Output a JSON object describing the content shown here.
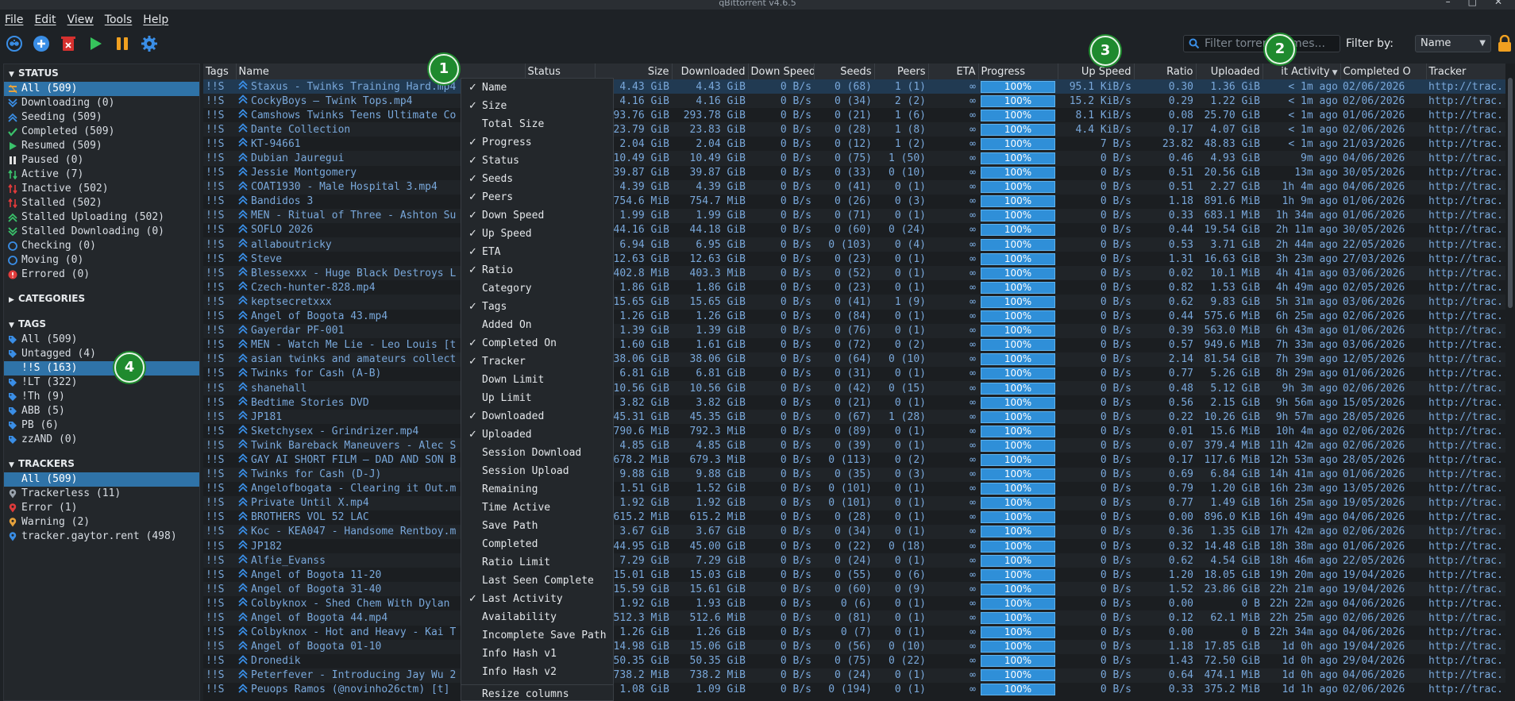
{
  "window": {
    "title": "qBittorrent v4.6.5"
  },
  "menu": [
    "File",
    "Edit",
    "View",
    "Tools",
    "Help"
  ],
  "toolbar": {
    "buttons": [
      "add-link",
      "add-torrent",
      "remove",
      "resume",
      "pause",
      "options"
    ]
  },
  "filter": {
    "placeholder": "Filter torrent names...",
    "label": "Filter by:",
    "selected": "Name"
  },
  "sidebar": {
    "status_title": "STATUS",
    "status": [
      {
        "label": "All (509)",
        "icon": "all-icon",
        "color": "#e6a23c"
      },
      {
        "label": "Downloading (0)",
        "icon": "downloading-icon",
        "color": "#3a8ee6"
      },
      {
        "label": "Seeding (509)",
        "icon": "seeding-icon",
        "color": "#3a8ee6"
      },
      {
        "label": "Completed (509)",
        "icon": "completed-icon",
        "color": "#3ac26b"
      },
      {
        "label": "Resumed (509)",
        "icon": "resumed-icon",
        "color": "#3ac26b"
      },
      {
        "label": "Paused (0)",
        "icon": "paused-icon",
        "color": "#e0e0e0"
      },
      {
        "label": "Active (7)",
        "icon": "active-icon",
        "color": "#3ac26b"
      },
      {
        "label": "Inactive (502)",
        "icon": "inactive-icon",
        "color": "#e03b3b"
      },
      {
        "label": "Stalled (502)",
        "icon": "stalled-icon",
        "color": "#e03b3b"
      },
      {
        "label": "Stalled Uploading (502)",
        "icon": "stalled-uploading-icon",
        "color": "#3ac26b"
      },
      {
        "label": "Stalled Downloading (0)",
        "icon": "stalled-downloading-icon",
        "color": "#3ac26b"
      },
      {
        "label": "Checking (0)",
        "icon": "checking-icon",
        "color": "#3a8ee6"
      },
      {
        "label": "Moving (0)",
        "icon": "moving-icon",
        "color": "#3a8ee6"
      },
      {
        "label": "Errored (0)",
        "icon": "errored-icon",
        "color": "#e03b3b"
      }
    ],
    "categories_title": "CATEGORIES",
    "tags_title": "TAGS",
    "tags": [
      {
        "label": "All (509)"
      },
      {
        "label": "Untagged (4)"
      },
      {
        "label": "!!S (163)"
      },
      {
        "label": "!LT (322)"
      },
      {
        "label": "!Th (9)"
      },
      {
        "label": "ABB (5)"
      },
      {
        "label": "PB (6)"
      },
      {
        "label": "zzAND (0)"
      }
    ],
    "trackers_title": "TRACKERS",
    "trackers": [
      {
        "label": "All (509)",
        "color": "#3a8ee6"
      },
      {
        "label": "Trackerless (11)",
        "color": "#9aa3ad"
      },
      {
        "label": "Error (1)",
        "color": "#e03b3b"
      },
      {
        "label": "Warning (2)",
        "color": "#e6a23c"
      },
      {
        "label": "tracker.gaytor.rent (498)",
        "color": "#3a8ee6"
      }
    ]
  },
  "columns": [
    "Tags",
    "Name",
    "Status",
    "Size",
    "Downloaded",
    "Down Speed",
    "Seeds",
    "Peers",
    "ETA",
    "Progress",
    "Up Speed",
    "Ratio",
    "Uploaded",
    "it Activity",
    "Completed O",
    "Tracker"
  ],
  "rows": [
    [
      "!!S",
      "Staxus - Twinks Training Hard.mp4",
      "",
      "4.43 GiB",
      "4.43 GiB",
      "0 B/s",
      "0 (68)",
      "1 (1)",
      "∞",
      "100%",
      "95.1 KiB/s",
      "0.30",
      "1.36 GiB",
      "< 1m ago",
      "02/06/2026",
      "http://trac..."
    ],
    [
      "!!S",
      "CockyBoys – Twink Tops.mp4",
      "",
      "4.16 GiB",
      "4.16 GiB",
      "0 B/s",
      "0 (34)",
      "2 (2)",
      "∞",
      "100%",
      "15.2 KiB/s",
      "0.29",
      "1.22 GiB",
      "< 1m ago",
      "02/06/2026",
      "http://trac..."
    ],
    [
      "!!S",
      "Camshows Twinks Teens Ultimate Co",
      "",
      "293.76 GiB",
      "293.78 GiB",
      "0 B/s",
      "0 (21)",
      "1 (6)",
      "∞",
      "100%",
      "8.1 KiB/s",
      "0.08",
      "25.70 GiB",
      "< 1m ago",
      "01/06/2026",
      "http://trac..."
    ],
    [
      "!!S",
      "Dante Collection",
      "",
      "23.79 GiB",
      "23.83 GiB",
      "0 B/s",
      "0 (28)",
      "1 (8)",
      "∞",
      "100%",
      "4.4 KiB/s",
      "0.17",
      "4.07 GiB",
      "< 1m ago",
      "02/06/2026",
      "http://trac..."
    ],
    [
      "!!S",
      "KT-94661",
      "",
      "2.04 GiB",
      "2.04 GiB",
      "0 B/s",
      "0 (12)",
      "1 (2)",
      "∞",
      "100%",
      "7 B/s",
      "23.82",
      "48.83 GiB",
      "< 1m ago",
      "21/03/2026",
      "http://trac..."
    ],
    [
      "!!S",
      "Dubian Jauregui",
      "",
      "10.49 GiB",
      "10.49 GiB",
      "0 B/s",
      "0 (75)",
      "1 (50)",
      "∞",
      "100%",
      "0 B/s",
      "0.46",
      "4.93 GiB",
      "9m ago",
      "04/06/2026",
      "http://trac..."
    ],
    [
      "!!S",
      "Jessie Montgomery",
      "",
      "39.87 GiB",
      "39.87 GiB",
      "0 B/s",
      "0 (33)",
      "0 (10)",
      "∞",
      "100%",
      "0 B/s",
      "0.51",
      "20.56 GiB",
      "13m ago",
      "30/05/2026",
      "http://trac..."
    ],
    [
      "!!S",
      "COAT1930 - Male Hospital 3.mp4",
      "",
      "4.39 GiB",
      "4.39 GiB",
      "0 B/s",
      "0 (41)",
      "0 (1)",
      "∞",
      "100%",
      "0 B/s",
      "0.51",
      "2.27 GiB",
      "1h 4m ago",
      "04/06/2026",
      "http://trac..."
    ],
    [
      "!!S",
      "Bandidos 3",
      "",
      "754.6 MiB",
      "754.7 MiB",
      "0 B/s",
      "0 (26)",
      "0 (3)",
      "∞",
      "100%",
      "0 B/s",
      "1.18",
      "891.6 MiB",
      "1h 9m ago",
      "01/06/2026",
      "http://trac..."
    ],
    [
      "!!S",
      "MEN - Ritual of Three - Ashton Su",
      "",
      "1.99 GiB",
      "1.99 GiB",
      "0 B/s",
      "0 (71)",
      "0 (1)",
      "∞",
      "100%",
      "0 B/s",
      "0.33",
      "683.1 MiB",
      "1h 34m ago",
      "01/06/2026",
      "http://trac..."
    ],
    [
      "!!S",
      "SOFLO 2026",
      "",
      "44.16 GiB",
      "44.18 GiB",
      "0 B/s",
      "0 (60)",
      "0 (24)",
      "∞",
      "100%",
      "0 B/s",
      "0.44",
      "19.54 GiB",
      "2h 11m ago",
      "30/05/2026",
      "http://trac..."
    ],
    [
      "!!S",
      "allaboutricky",
      "",
      "6.94 GiB",
      "6.95 GiB",
      "0 B/s",
      "0 (103)",
      "0 (4)",
      "∞",
      "100%",
      "0 B/s",
      "0.53",
      "3.71 GiB",
      "2h 44m ago",
      "22/05/2026",
      "http://trac..."
    ],
    [
      "!!S",
      "Steve",
      "",
      "12.63 GiB",
      "12.63 GiB",
      "0 B/s",
      "0 (23)",
      "0 (1)",
      "∞",
      "100%",
      "0 B/s",
      "1.31",
      "16.63 GiB",
      "3h 23m ago",
      "27/03/2026",
      "http://trac..."
    ],
    [
      "!!S",
      "Blessexxx - Huge Black Destroys L",
      "",
      "402.8 MiB",
      "403.3 MiB",
      "0 B/s",
      "0 (52)",
      "0 (1)",
      "∞",
      "100%",
      "0 B/s",
      "0.02",
      "10.1 MiB",
      "4h 41m ago",
      "03/06/2026",
      "http://trac..."
    ],
    [
      "!!S",
      "Czech-hunter-828.mp4",
      "",
      "1.86 GiB",
      "1.86 GiB",
      "0 B/s",
      "0 (23)",
      "0 (1)",
      "∞",
      "100%",
      "0 B/s",
      "0.82",
      "1.53 GiB",
      "4h 49m ago",
      "02/05/2026",
      "http://trac..."
    ],
    [
      "!!S",
      "keptsecretxxx",
      "",
      "15.65 GiB",
      "15.65 GiB",
      "0 B/s",
      "0 (41)",
      "1 (9)",
      "∞",
      "100%",
      "0 B/s",
      "0.62",
      "9.83 GiB",
      "5h 31m ago",
      "03/06/2026",
      "http://trac..."
    ],
    [
      "!!S",
      "Angel of Bogota 43.mp4",
      "",
      "1.26 GiB",
      "1.26 GiB",
      "0 B/s",
      "0 (84)",
      "0 (1)",
      "∞",
      "100%",
      "0 B/s",
      "0.44",
      "575.6 MiB",
      "6h 25m ago",
      "02/06/2026",
      "http://trac..."
    ],
    [
      "!!S",
      "Gayerdar PF-001",
      "",
      "1.39 GiB",
      "1.39 GiB",
      "0 B/s",
      "0 (76)",
      "0 (1)",
      "∞",
      "100%",
      "0 B/s",
      "0.39",
      "563.0 MiB",
      "6h 43m ago",
      "01/06/2026",
      "http://trac..."
    ],
    [
      "!!S",
      "MEN - Watch Me Lie - Leo Louis [t",
      "",
      "1.60 GiB",
      "1.61 GiB",
      "0 B/s",
      "0 (72)",
      "0 (2)",
      "∞",
      "100%",
      "0 B/s",
      "0.57",
      "949.6 MiB",
      "7h 33m ago",
      "03/06/2026",
      "http://trac..."
    ],
    [
      "!!S",
      "asian twinks and amateurs collect",
      "",
      "38.06 GiB",
      "38.06 GiB",
      "0 B/s",
      "0 (64)",
      "0 (10)",
      "∞",
      "100%",
      "0 B/s",
      "2.14",
      "81.54 GiB",
      "7h 39m ago",
      "12/05/2026",
      "http://trac..."
    ],
    [
      "!!S",
      "Twinks for Cash (A-B)",
      "",
      "6.81 GiB",
      "6.81 GiB",
      "0 B/s",
      "0 (31)",
      "0 (1)",
      "∞",
      "100%",
      "0 B/s",
      "0.77",
      "5.26 GiB",
      "8h 29m ago",
      "01/06/2026",
      "http://trac..."
    ],
    [
      "!!S",
      "shanehall",
      "",
      "10.56 GiB",
      "10.56 GiB",
      "0 B/s",
      "0 (42)",
      "0 (15)",
      "∞",
      "100%",
      "0 B/s",
      "0.48",
      "5.12 GiB",
      "9h 3m ago",
      "02/06/2026",
      "http://trac..."
    ],
    [
      "!!S",
      "Bedtime Stories DVD",
      "",
      "3.82 GiB",
      "3.82 GiB",
      "0 B/s",
      "0 (21)",
      "0 (1)",
      "∞",
      "100%",
      "0 B/s",
      "0.56",
      "2.15 GiB",
      "9h 56m ago",
      "15/05/2026",
      "http://trac..."
    ],
    [
      "!!S",
      "JP181",
      "",
      "45.31 GiB",
      "45.35 GiB",
      "0 B/s",
      "0 (67)",
      "1 (28)",
      "∞",
      "100%",
      "0 B/s",
      "0.22",
      "10.26 GiB",
      "9h 57m ago",
      "28/05/2026",
      "http://trac..."
    ],
    [
      "!!S",
      "Sketchysex - Grindrizer.mp4",
      "",
      "790.6 MiB",
      "792.3 MiB",
      "0 B/s",
      "0 (89)",
      "0 (1)",
      "∞",
      "100%",
      "0 B/s",
      "0.01",
      "15.6 MiB",
      "10h 4m ago",
      "02/06/2026",
      "http://trac..."
    ],
    [
      "!!S",
      "Twink Bareback Maneuvers - Alec S",
      "",
      "4.85 GiB",
      "4.85 GiB",
      "0 B/s",
      "0 (39)",
      "0 (1)",
      "∞",
      "100%",
      "0 B/s",
      "0.07",
      "379.4 MiB",
      "11h 42m ago",
      "02/06/2026",
      "http://trac..."
    ],
    [
      "!!S",
      "GAY AI SHORT FILM – DAD AND SON B",
      "",
      "678.2 MiB",
      "679.3 MiB",
      "0 B/s",
      "0 (113)",
      "0 (2)",
      "∞",
      "100%",
      "0 B/s",
      "0.17",
      "117.6 MiB",
      "12h 53m ago",
      "28/05/2026",
      "http://trac..."
    ],
    [
      "!!S",
      "Twinks for Cash (D-J)",
      "",
      "9.88 GiB",
      "9.88 GiB",
      "0 B/s",
      "0 (35)",
      "0 (3)",
      "∞",
      "100%",
      "0 B/s",
      "0.69",
      "6.84 GiB",
      "14h 41m ago",
      "01/06/2026",
      "http://trac..."
    ],
    [
      "!!S",
      "Angelofbogata - Clearing it Out.m",
      "",
      "1.51 GiB",
      "1.52 GiB",
      "0 B/s",
      "0 (101)",
      "0 (1)",
      "∞",
      "100%",
      "0 B/s",
      "0.79",
      "1.20 GiB",
      "16h 23m ago",
      "13/05/2026",
      "http://trac..."
    ],
    [
      "!!S",
      "Private Until X.mp4",
      "",
      "1.92 GiB",
      "1.92 GiB",
      "0 B/s",
      "0 (101)",
      "0 (1)",
      "∞",
      "100%",
      "0 B/s",
      "0.77",
      "1.49 GiB",
      "16h 25m ago",
      "19/05/2026",
      "http://trac..."
    ],
    [
      "!!S",
      "BROTHERS VOL 52 LAC",
      "",
      "615.2 MiB",
      "615.2 MiB",
      "0 B/s",
      "0 (28)",
      "0 (1)",
      "∞",
      "100%",
      "0 B/s",
      "0.00",
      "896.0 KiB",
      "16h 49m ago",
      "04/06/2026",
      "http://trac..."
    ],
    [
      "!!S",
      "Koc - KEA047 - Handsome Rentboy.m",
      "",
      "3.67 GiB",
      "3.67 GiB",
      "0 B/s",
      "0 (34)",
      "0 (1)",
      "∞",
      "100%",
      "0 B/s",
      "0.36",
      "1.35 GiB",
      "17h 42m ago",
      "02/06/2026",
      "http://trac..."
    ],
    [
      "!!S",
      "JP182",
      "",
      "44.95 GiB",
      "45.00 GiB",
      "0 B/s",
      "0 (22)",
      "0 (18)",
      "∞",
      "100%",
      "0 B/s",
      "0.32",
      "14.48 GiB",
      "18h 38m ago",
      "01/06/2026",
      "http://trac..."
    ],
    [
      "!!S",
      "Alfie_Evanss",
      "",
      "7.29 GiB",
      "7.29 GiB",
      "0 B/s",
      "0 (24)",
      "0 (1)",
      "∞",
      "100%",
      "0 B/s",
      "0.62",
      "4.54 GiB",
      "18h 46m ago",
      "22/05/2026",
      "http://trac..."
    ],
    [
      "!!S",
      "Angel of Bogota 11-20",
      "",
      "15.01 GiB",
      "15.03 GiB",
      "0 B/s",
      "0 (55)",
      "0 (6)",
      "∞",
      "100%",
      "0 B/s",
      "1.20",
      "18.05 GiB",
      "19h 20m ago",
      "19/04/2026",
      "http://trac..."
    ],
    [
      "!!S",
      "Angel of Bogota 31-40",
      "",
      "15.59 GiB",
      "15.61 GiB",
      "0 B/s",
      "0 (60)",
      "0 (9)",
      "∞",
      "100%",
      "0 B/s",
      "1.52",
      "23.86 GiB",
      "22h 21m ago",
      "19/04/2026",
      "http://trac..."
    ],
    [
      "!!S",
      "Colbyknox - Shed Chem With Dylan",
      "",
      "1.92 GiB",
      "1.93 GiB",
      "0 B/s",
      "0 (6)",
      "0 (1)",
      "∞",
      "100%",
      "0 B/s",
      "0.00",
      "0 B",
      "22h 22m ago",
      "04/06/2026",
      "http://trac..."
    ],
    [
      "!!S",
      "Angel of Bogota 44.mp4",
      "",
      "512.3 MiB",
      "512.6 MiB",
      "0 B/s",
      "0 (81)",
      "0 (1)",
      "∞",
      "100%",
      "0 B/s",
      "0.12",
      "62.1 MiB",
      "22h 25m ago",
      "02/06/2026",
      "http://trac..."
    ],
    [
      "!!S",
      "Colbyknox - Hot and Heavy - Kai T",
      "",
      "1.26 GiB",
      "1.26 GiB",
      "0 B/s",
      "0 (7)",
      "0 (1)",
      "∞",
      "100%",
      "0 B/s",
      "0.00",
      "0 B",
      "22h 34m ago",
      "04/06/2026",
      "http://trac..."
    ],
    [
      "!!S",
      "Angel of Bogota 01-10",
      "",
      "14.98 GiB",
      "15.06 GiB",
      "0 B/s",
      "0 (56)",
      "0 (10)",
      "∞",
      "100%",
      "0 B/s",
      "1.18",
      "17.85 GiB",
      "1d 0h ago",
      "19/04/2026",
      "http://trac..."
    ],
    [
      "!!S",
      "Dronedik",
      "",
      "50.35 GiB",
      "50.35 GiB",
      "0 B/s",
      "0 (75)",
      "0 (22)",
      "∞",
      "100%",
      "0 B/s",
      "1.43",
      "72.50 GiB",
      "1d 0h ago",
      "29/04/2026",
      "http://trac..."
    ],
    [
      "!!S",
      "Peterfever - Introducing Jay Wu 2",
      "",
      "738.2 MiB",
      "738.2 MiB",
      "0 B/s",
      "0 (24)",
      "0 (1)",
      "∞",
      "100%",
      "0 B/s",
      "0.64",
      "474.1 MiB",
      "1d 0h ago",
      "04/06/2026",
      "http://trac..."
    ],
    [
      "!!S",
      "Peuops Ramos (@novinho26ctm) [t]",
      "",
      "1.08 GiB",
      "1.09 GiB",
      "0 B/s",
      "0 (194)",
      "0 (1)",
      "∞",
      "100%",
      "0 B/s",
      "0.33",
      "375.2 MiB",
      "1d 1h ago",
      "02/06/2026",
      "http://trac..."
    ]
  ],
  "context_menu": [
    {
      "label": "Name",
      "checked": true
    },
    {
      "label": "Size",
      "checked": true
    },
    {
      "label": "Total Size",
      "checked": false
    },
    {
      "label": "Progress",
      "checked": true
    },
    {
      "label": "Status",
      "checked": true
    },
    {
      "label": "Seeds",
      "checked": true
    },
    {
      "label": "Peers",
      "checked": true
    },
    {
      "label": "Down Speed",
      "checked": true
    },
    {
      "label": "Up Speed",
      "checked": true
    },
    {
      "label": "ETA",
      "checked": true
    },
    {
      "label": "Ratio",
      "checked": true
    },
    {
      "label": "Category",
      "checked": false
    },
    {
      "label": "Tags",
      "checked": true
    },
    {
      "label": "Added On",
      "checked": false
    },
    {
      "label": "Completed On",
      "checked": true
    },
    {
      "label": "Tracker",
      "checked": true
    },
    {
      "label": "Down Limit",
      "checked": false
    },
    {
      "label": "Up Limit",
      "checked": false
    },
    {
      "label": "Downloaded",
      "checked": true
    },
    {
      "label": "Uploaded",
      "checked": true
    },
    {
      "label": "Session Download",
      "checked": false
    },
    {
      "label": "Session Upload",
      "checked": false
    },
    {
      "label": "Remaining",
      "checked": false
    },
    {
      "label": "Time Active",
      "checked": false
    },
    {
      "label": "Save Path",
      "checked": false
    },
    {
      "label": "Completed",
      "checked": false
    },
    {
      "label": "Ratio Limit",
      "checked": false
    },
    {
      "label": "Last Seen Complete",
      "checked": false
    },
    {
      "label": "Last Activity",
      "checked": true
    },
    {
      "label": "Availability",
      "checked": false
    },
    {
      "label": "Incomplete Save Path",
      "checked": false
    },
    {
      "label": "Info Hash v1",
      "checked": false
    },
    {
      "label": "Info Hash v2",
      "checked": false
    },
    {
      "label": "Resize columns",
      "checked": false,
      "separator": true
    }
  ],
  "badges": [
    "1",
    "2",
    "3",
    "4"
  ],
  "colors": {
    "accent": "#2f73a8",
    "progress": "#2f8fd8",
    "badge": "#1f8a2e",
    "link": "#79a8db"
  }
}
